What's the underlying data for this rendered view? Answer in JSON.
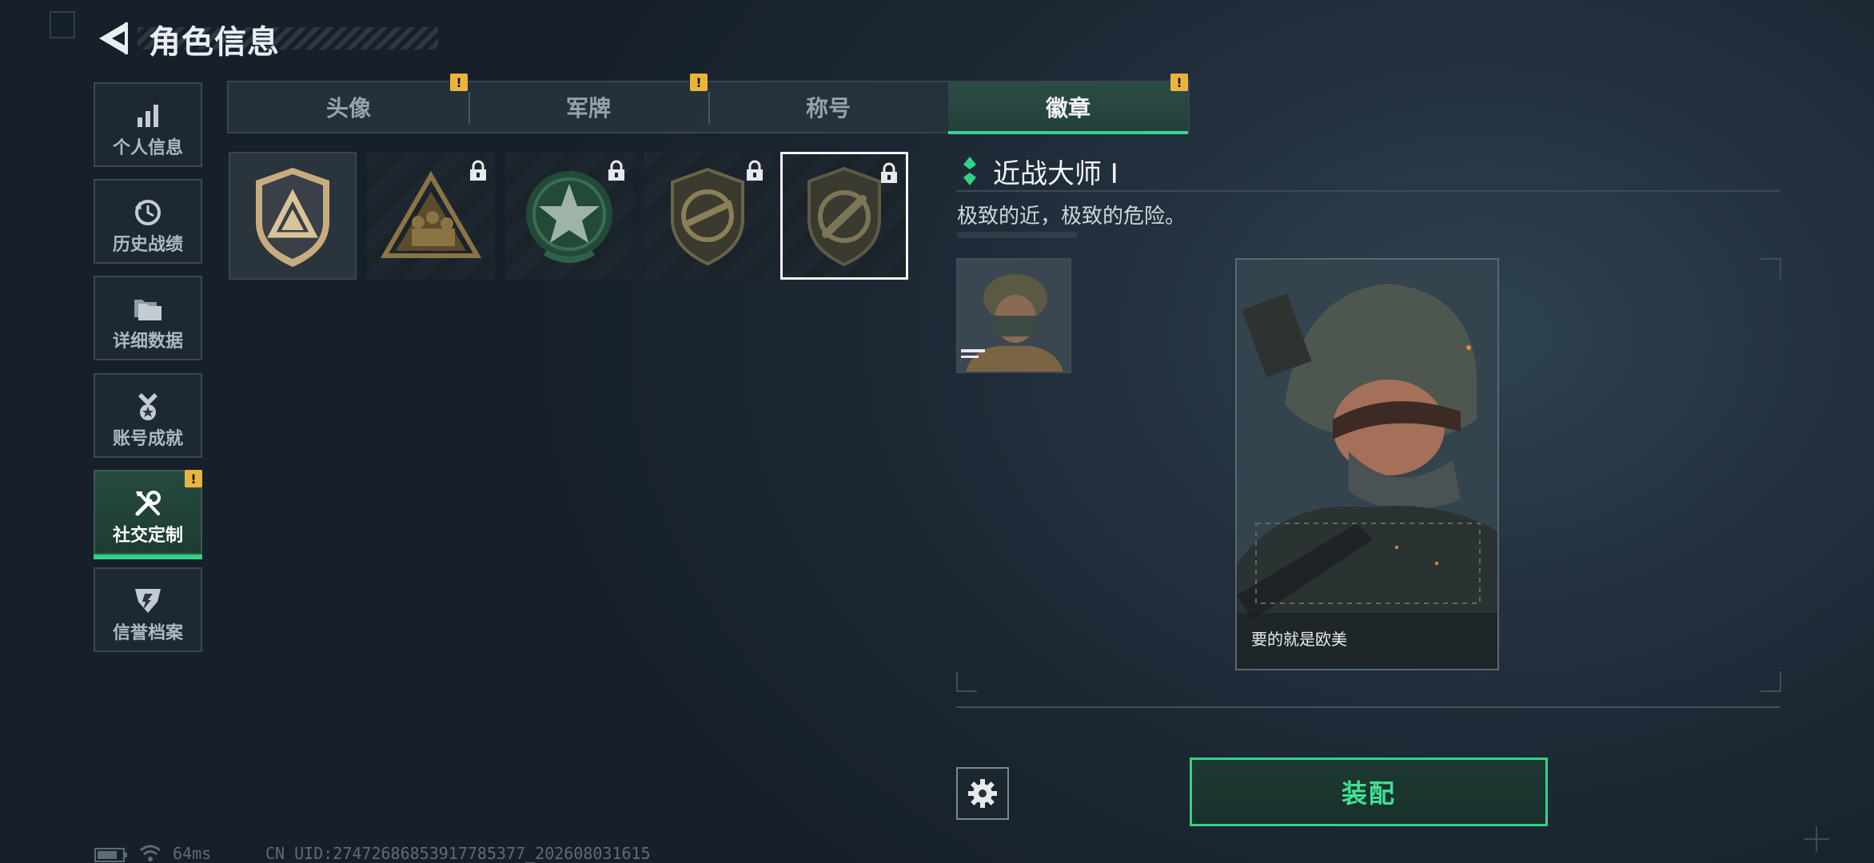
{
  "header": {
    "title": "角色信息"
  },
  "sidebar": {
    "items": [
      {
        "label": "个人信息",
        "icon": "bar-chart-icon"
      },
      {
        "label": "历史战绩",
        "icon": "history-clock-icon"
      },
      {
        "label": "详细数据",
        "icon": "folders-icon"
      },
      {
        "label": "账号成就",
        "icon": "medal-icon"
      },
      {
        "label": "社交定制",
        "icon": "tools-icon",
        "active": true,
        "alert": "!"
      },
      {
        "label": "信誉档案",
        "icon": "emblem-icon"
      }
    ]
  },
  "tabs": [
    {
      "label": "头像",
      "alert": "!"
    },
    {
      "label": "军牌",
      "alert": "!"
    },
    {
      "label": "称号"
    },
    {
      "label": "徽章",
      "active": true,
      "alert": "!"
    }
  ],
  "badges": [
    {
      "name": "triangle-shield-badge",
      "locked": false
    },
    {
      "name": "squad-triangle-badge",
      "locked": true
    },
    {
      "name": "star-wreath-badge",
      "locked": true
    },
    {
      "name": "rifle-shield-badge",
      "locked": true
    },
    {
      "name": "knife-shield-badge",
      "locked": true,
      "selected": true
    }
  ],
  "detail": {
    "title": "近战大师 Ⅰ",
    "description": "极致的近，极致的危险。",
    "card_name": "要的就是欧美"
  },
  "actions": {
    "equip_label": "装配"
  },
  "status": {
    "ping": "64ms",
    "uid": "CN UID:27472686853917785377_202608031615"
  },
  "colors": {
    "accent": "#2fd486",
    "alert": "#e9b43c"
  }
}
